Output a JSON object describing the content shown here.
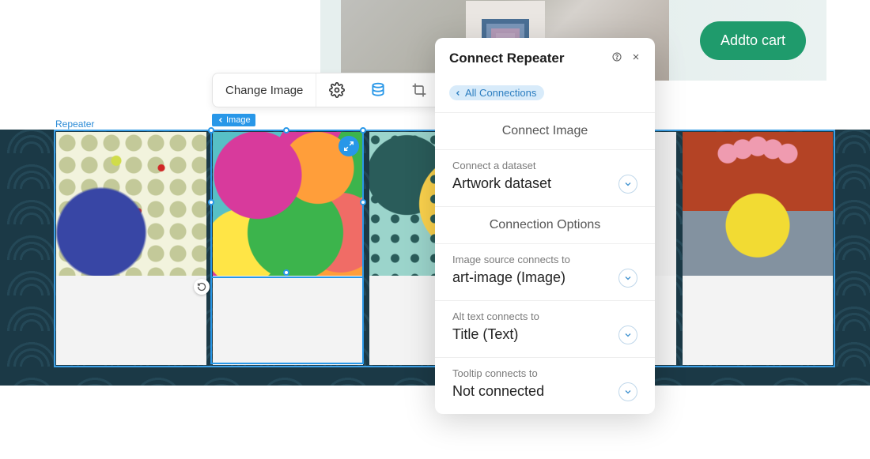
{
  "hero": {
    "addToCart": "Addto cart"
  },
  "toolbar": {
    "changeImage": "Change Image"
  },
  "repeaterLabel": "Repeater",
  "imageTag": "Image",
  "panel": {
    "title": "Connect Repeater",
    "breadcrumb": "All Connections",
    "sections": {
      "connectImage": "Connect Image",
      "connectionOptions": "Connection Options"
    },
    "fields": {
      "dataset": {
        "label": "Connect a dataset",
        "value": "Artwork dataset"
      },
      "imageSource": {
        "label": "Image source connects to",
        "value": "art-image (Image)"
      },
      "altText": {
        "label": "Alt text connects to",
        "value": "Title (Text)"
      },
      "tooltip": {
        "label": "Tooltip connects to",
        "value": "Not connected"
      }
    }
  }
}
